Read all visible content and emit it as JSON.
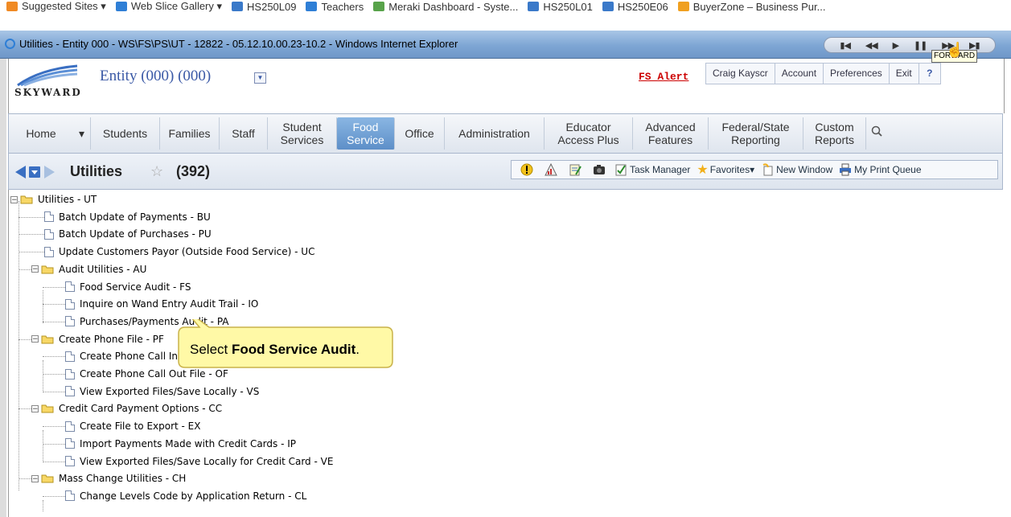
{
  "favorites": [
    {
      "label": "Suggested Sites ▾",
      "icon": "suggested-sites-icon",
      "color": "#f08a24"
    },
    {
      "label": "Web Slice Gallery ▾",
      "icon": "ie-icon",
      "color": "#2f7fd6"
    },
    {
      "label": "HS250L09",
      "icon": "computer-icon",
      "color": "#3a79c9"
    },
    {
      "label": "Teachers",
      "icon": "ie-icon",
      "color": "#2f7fd6"
    },
    {
      "label": "Meraki Dashboard - Syste...",
      "icon": "meraki-icon",
      "color": "#58a34a"
    },
    {
      "label": "HS250L01",
      "icon": "computer-icon",
      "color": "#3a79c9"
    },
    {
      "label": "HS250E06",
      "icon": "computer-icon",
      "color": "#3a79c9"
    },
    {
      "label": "BuyerZone – Business Pur...",
      "icon": "buyerzone-icon",
      "color": "#f0a020"
    }
  ],
  "window": {
    "title": "Utilities - Entity 000 - WS\\FS\\PS\\UT - 12822 - 05.12.10.00.23-10.2 - Windows Internet Explorer",
    "tooltip": "FORWARD"
  },
  "header": {
    "logo_text": "SKYWARD",
    "entity": "Entity (000) (000)",
    "alert": "FS Alert",
    "user": "Craig Kayscr",
    "links": [
      "Account",
      "Preferences",
      "Exit",
      "?"
    ]
  },
  "nav": {
    "tabs": [
      {
        "label": "Home",
        "active": false
      },
      {
        "label": "▾",
        "active": false
      },
      {
        "label": "Students",
        "active": false
      },
      {
        "label": "Families",
        "active": false
      },
      {
        "label": "Staff",
        "active": false
      },
      {
        "label": "Student\nServices",
        "active": false
      },
      {
        "label": "Food\nService",
        "active": true
      },
      {
        "label": "Office",
        "active": false
      },
      {
        "label": "Administration",
        "active": false
      },
      {
        "label": "Educator\nAccess Plus",
        "active": false
      },
      {
        "label": "Advanced\nFeatures",
        "active": false
      },
      {
        "label": "Federal/State\nReporting",
        "active": false
      },
      {
        "label": "Custom\nReports",
        "active": false
      }
    ]
  },
  "page": {
    "title": "Utilities",
    "count": "(392)"
  },
  "toolbar": {
    "task_manager": "Task Manager",
    "favorites": "Favorites▾",
    "new_window": "New Window",
    "print_queue": "My Print Queue"
  },
  "tree": [
    {
      "label": "Utilities - UT",
      "type": "folder",
      "level": 0
    },
    {
      "label": "Batch Update of Payments - BU",
      "type": "doc",
      "level": 1
    },
    {
      "label": "Batch Update of Purchases - PU",
      "type": "doc",
      "level": 1
    },
    {
      "label": "Update Customers Payor (Outside Food Service) - UC",
      "type": "doc",
      "level": 1
    },
    {
      "label": "Audit Utilities - AU",
      "type": "folder",
      "level": 1
    },
    {
      "label": "Food Service Audit - FS",
      "type": "doc",
      "level": 2
    },
    {
      "label": "Inquire on Wand Entry Audit Trail - IO",
      "type": "doc",
      "level": 2
    },
    {
      "label": "Purchases/Payments Audit - PA",
      "type": "doc",
      "level": 2
    },
    {
      "label": "Create Phone File - PF",
      "type": "folder",
      "level": 1
    },
    {
      "label": "Create Phone Call In File - CP",
      "type": "doc",
      "level": 2
    },
    {
      "label": "Create Phone Call Out File - OF",
      "type": "doc",
      "level": 2
    },
    {
      "label": "View Exported Files/Save Locally - VS",
      "type": "doc",
      "level": 2
    },
    {
      "label": "Credit Card Payment Options - CC",
      "type": "folder",
      "level": 1
    },
    {
      "label": "Create File to Export - EX",
      "type": "doc",
      "level": 2
    },
    {
      "label": "Import Payments Made with Credit Cards - IP",
      "type": "doc",
      "level": 2
    },
    {
      "label": "View Exported Files/Save Locally for Credit Card - VE",
      "type": "doc",
      "level": 2
    },
    {
      "label": "Mass Change Utilities - CH",
      "type": "folder",
      "level": 1
    },
    {
      "label": "Change Levels Code by Application Return - CL",
      "type": "doc",
      "level": 2
    }
  ],
  "callout": {
    "prefix": "Select ",
    "bold": "Food Service Audit",
    "suffix": "."
  },
  "colors": {
    "nav_active": "#5d8fc8",
    "entity_text": "#3a59a6",
    "alert": "#cc0000",
    "callout_fill": "#fff9a6"
  }
}
